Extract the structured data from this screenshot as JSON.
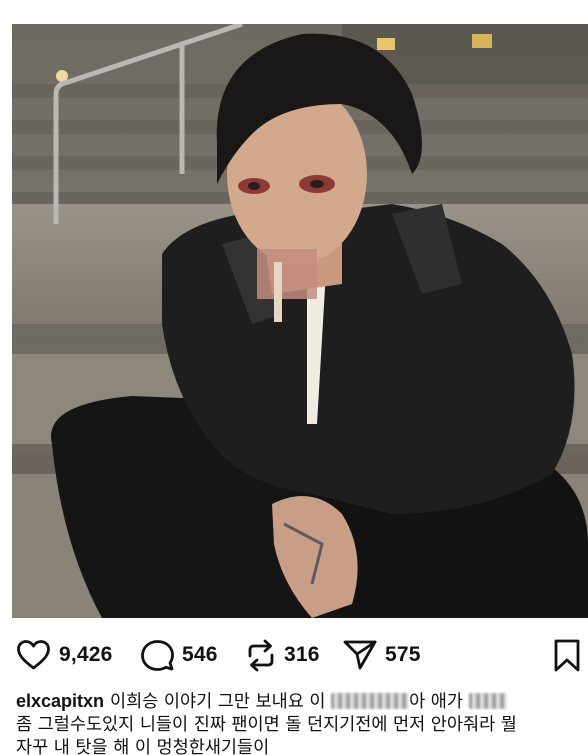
{
  "post": {
    "image_alt": "",
    "actions": {
      "like_icon": "heart-icon",
      "like_count": "9,426",
      "comment_icon": "comment-icon",
      "comment_count": "546",
      "repost_icon": "repost-icon",
      "repost_count": "316",
      "share_icon": "send-icon",
      "share_count": "575",
      "save_icon": "bookmark-icon"
    },
    "caption": {
      "username": "elxcapitxn",
      "line1_before": "이희승 이야기 그만 보내요 이 ",
      "line1_mid": "아 애가 ",
      "line2": "좀 그럴수도있지 니들이 진짜 팬이면 돌 던지기전에 먼저 안아줘라 뭘",
      "line3": "자꾸 내 탓을 해 이 멍청한새기들이"
    }
  }
}
